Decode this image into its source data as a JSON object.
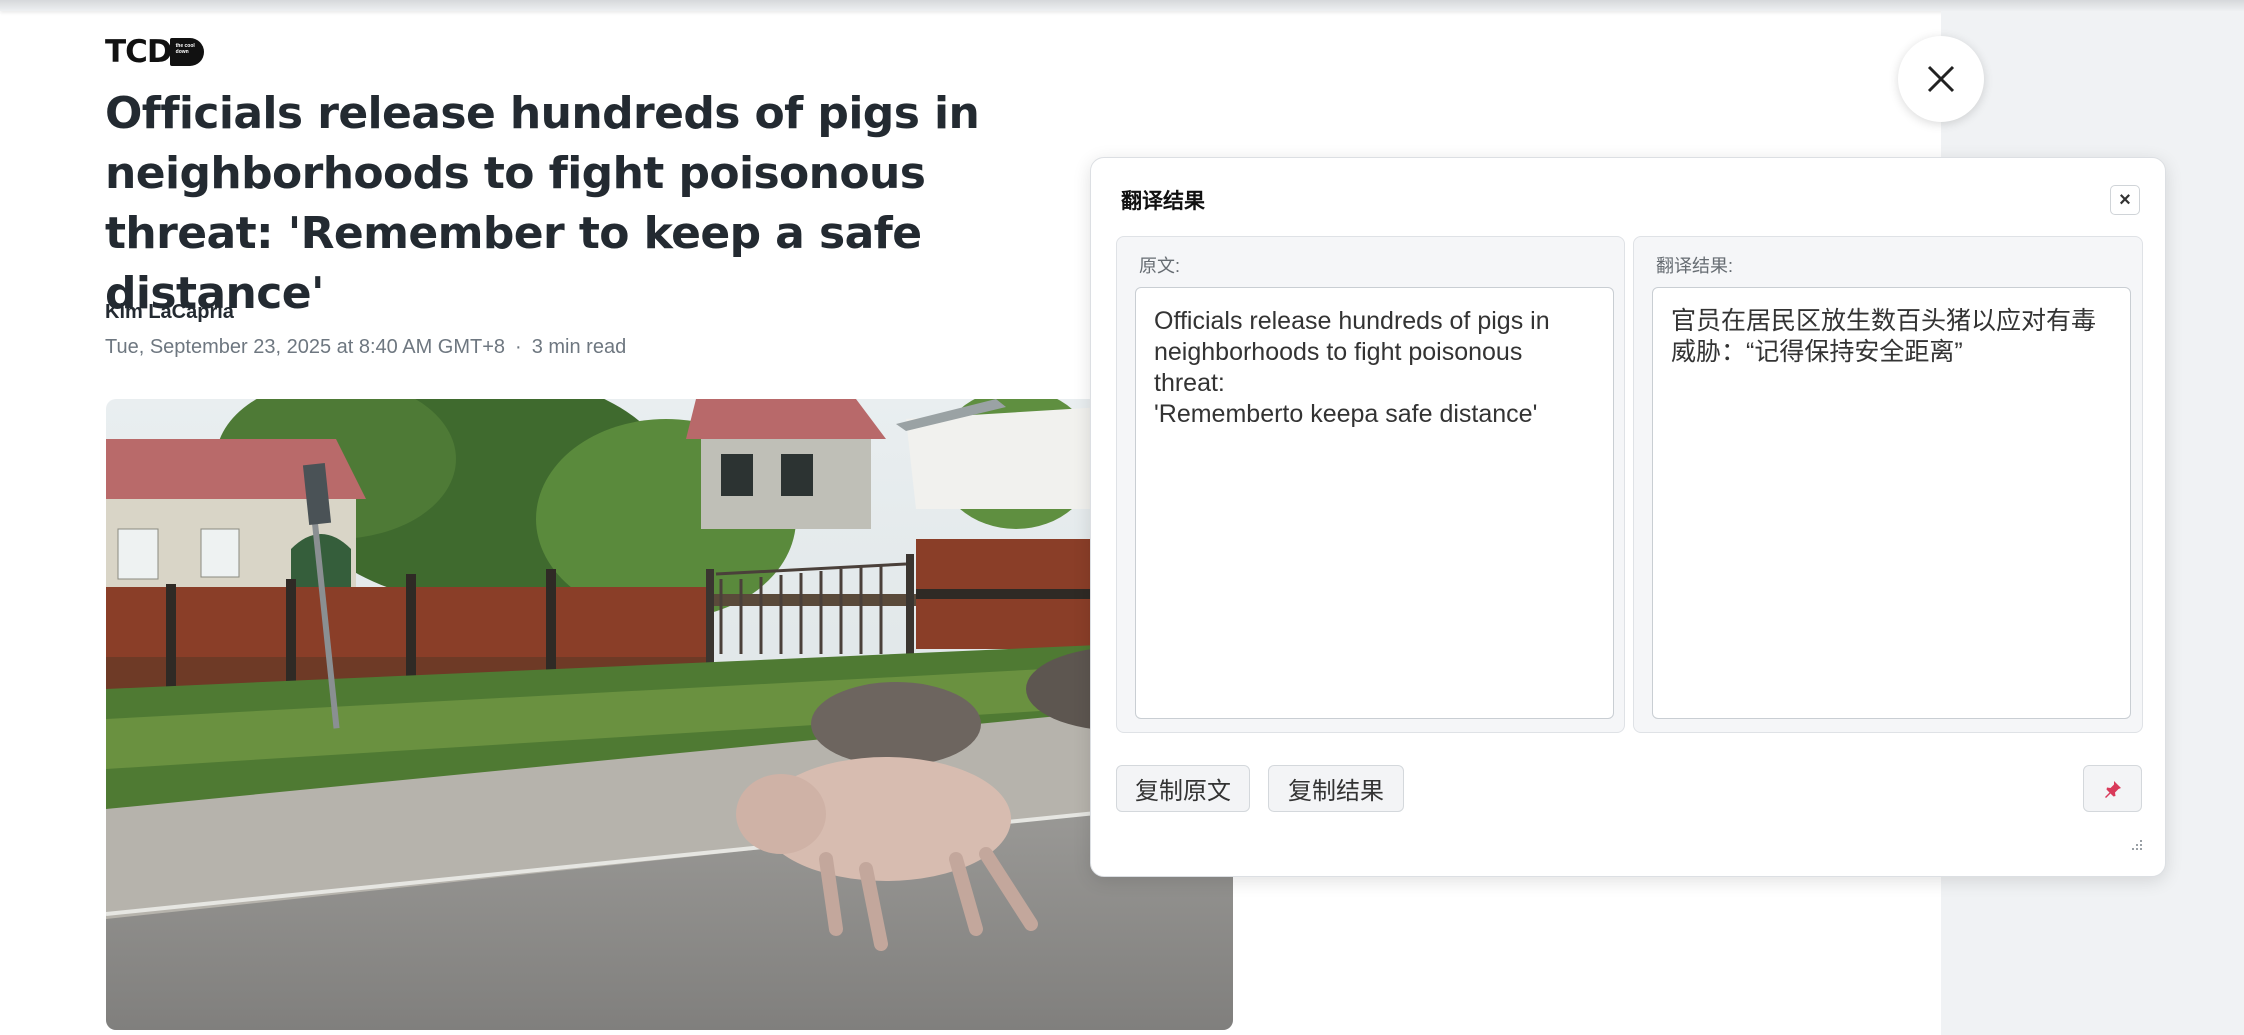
{
  "article": {
    "logo_text": "TCD",
    "logo_badge": "the cool down",
    "headline": "Officials release hundreds of pigs in neighborhoods to fight poisonous threat: 'Remember to keep a safe distance'",
    "author": "Kim LaCapria",
    "date": "Tue, September 23, 2025 at 8:40 AM GMT+8",
    "separator": "·",
    "read_time": "3 min read"
  },
  "translate_panel": {
    "title": "翻译结果",
    "close_label": "×",
    "source_label": "原文:",
    "source_text": "Officials release hundreds of pigs in neighborhoods to fight poisonous threat:\n'Rememberto keepa safe distance'",
    "result_label": "翻译结果:",
    "result_text": "官员在居民区放生数百头猪以应对有毒威胁：“记得保持安全距离”",
    "copy_source_label": "复制原文",
    "copy_result_label": "复制结果"
  },
  "icons": {
    "close": "close-icon",
    "pin": "pin-icon",
    "resize": "resize-grip-icon"
  },
  "colors": {
    "headline": "#232a31",
    "meta": "#6e7780",
    "pin": "#d93a5a"
  }
}
